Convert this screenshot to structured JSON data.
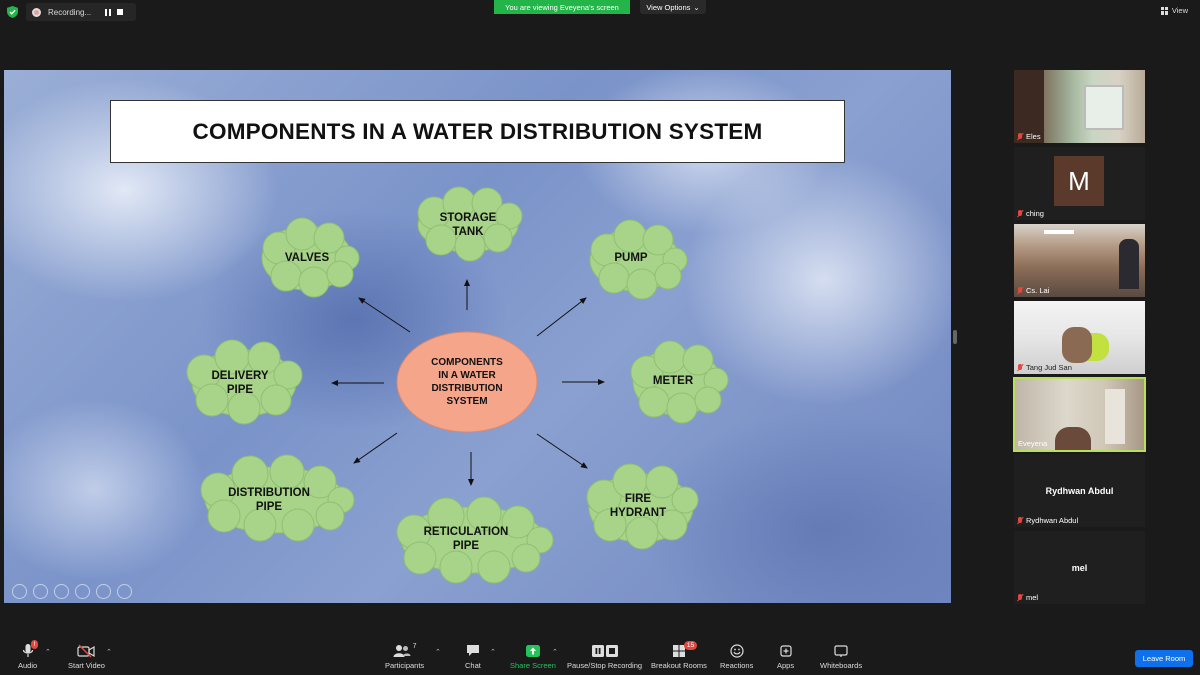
{
  "top_bar": {
    "recording_label": "Recording...",
    "viewing_banner": "You are viewing Eveyena's screen",
    "view_options_label": "View Options",
    "view_label": "View"
  },
  "slide": {
    "title": "COMPONENTS IN A WATER DISTRIBUTION SYSTEM",
    "center_node": [
      "COMPONENTS",
      "IN A WATER",
      "DISTRIBUTION",
      "SYSTEM"
    ],
    "nodes": {
      "storage_tank": [
        "STORAGE",
        "TANK"
      ],
      "valves": [
        "VALVES"
      ],
      "pump": [
        "PUMP"
      ],
      "delivery_pipe": [
        "DELIVERY",
        "PIPE"
      ],
      "meter": [
        "METER"
      ],
      "distribution_pipe": [
        "DISTRIBUTION",
        "PIPE"
      ],
      "reticulation_pipe": [
        "RETICULATION",
        "PIPE"
      ],
      "fire_hydrant": [
        "FIRE",
        "HYDRANT"
      ]
    },
    "colors": {
      "cloud_fill": "#a8d48a",
      "center_fill": "#f4a58a",
      "title_box": "#ffffff"
    }
  },
  "participants": [
    {
      "name": "Eles",
      "muted": true
    },
    {
      "name": "ching",
      "muted": true,
      "avatar_letter": "M"
    },
    {
      "name": "Cs. Lai",
      "muted": true
    },
    {
      "name": "Tang Jud San",
      "muted": true
    },
    {
      "name": "Eveyena",
      "muted": false,
      "active": true
    },
    {
      "name": "Rydhwan Abdul",
      "display_name": "Rydhwan Abdul",
      "muted": true
    },
    {
      "name": "mel",
      "display_name": "mel",
      "muted": true
    }
  ],
  "toolbar": {
    "audio": "Audio",
    "start_video": "Start Video",
    "participants": "Participants",
    "participants_count": "7",
    "chat": "Chat",
    "share_screen": "Share Screen",
    "pause_stop_recording": "Pause/Stop Recording",
    "breakout_rooms": "Breakout Rooms",
    "breakout_badge": "15",
    "reactions": "Reactions",
    "apps": "Apps",
    "whiteboards": "Whiteboards",
    "leave_room": "Leave Room",
    "audio_badge": "!"
  }
}
